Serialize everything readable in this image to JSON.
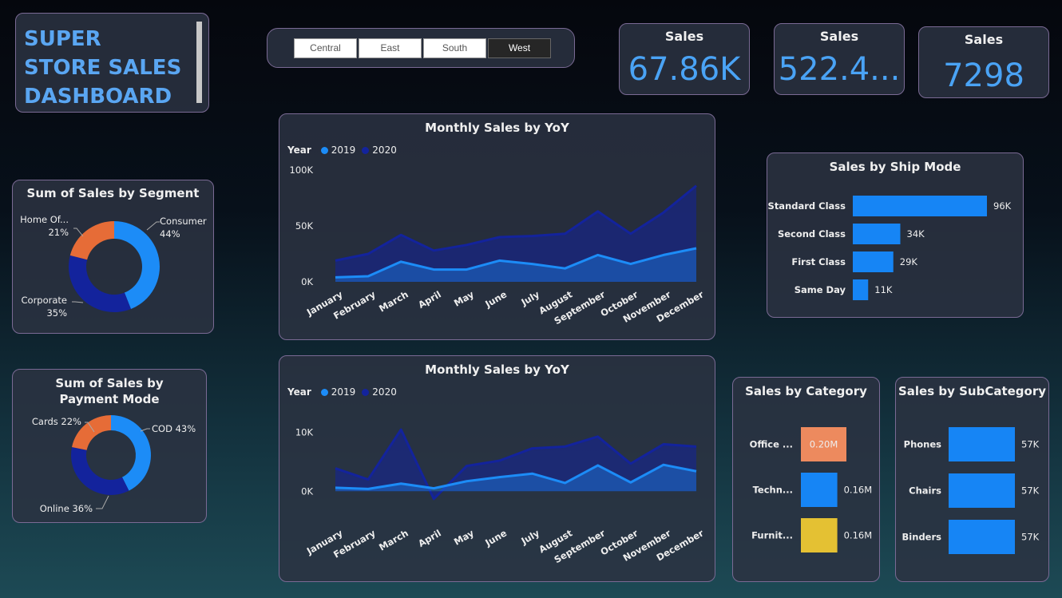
{
  "dashboard": {
    "title": "SUPER STORE SALES DASHBOARD"
  },
  "slicer": {
    "options": [
      "Central",
      "East",
      "South",
      "West"
    ],
    "selected": "West"
  },
  "kpis": [
    {
      "label": "Sales",
      "value": "67.86K"
    },
    {
      "label": "Sales",
      "value": "522.4..."
    },
    {
      "label": "Sales",
      "value": "7298"
    }
  ],
  "colors": {
    "c2019": "#1c8cf7",
    "c2020": "#13239c",
    "home": "#e66c37",
    "office": "#ed8a5e",
    "furniture": "#e4c133",
    "bar": "#1685f5"
  },
  "chart_data": [
    {
      "type": "pie",
      "title": "Sum of Sales by Segment",
      "slices": [
        {
          "label": "Consumer",
          "value": 44,
          "text": "44%"
        },
        {
          "label": "Corporate",
          "value": 35,
          "text": "35%"
        },
        {
          "label": "Home Of...",
          "value": 21,
          "text": "21%"
        }
      ]
    },
    {
      "type": "pie",
      "title": "Sum of Sales by Payment Mode",
      "slices": [
        {
          "label": "COD",
          "value": 43,
          "text": "COD 43%"
        },
        {
          "label": "Online",
          "value": 36,
          "text": "Online 36%"
        },
        {
          "label": "Cards",
          "value": 22,
          "text": "Cards 22%"
        }
      ]
    },
    {
      "type": "area",
      "title": "Monthly Sales by YoY",
      "legend_title": "Year",
      "categories": [
        "January",
        "February",
        "March",
        "April",
        "May",
        "June",
        "July",
        "August",
        "September",
        "October",
        "November",
        "December"
      ],
      "series": [
        {
          "name": "2019",
          "values": [
            4000,
            5000,
            18000,
            11000,
            11000,
            19000,
            16000,
            12000,
            24000,
            16000,
            24000,
            30000
          ]
        },
        {
          "name": "2020",
          "values": [
            19000,
            25000,
            42000,
            28000,
            33000,
            40000,
            41000,
            43000,
            63000,
            43000,
            62000,
            86000
          ]
        }
      ],
      "yticks": [
        {
          "v": 0,
          "label": "0K"
        },
        {
          "v": 50000,
          "label": "50K"
        },
        {
          "v": 100000,
          "label": "100K"
        }
      ],
      "ylim": [
        0,
        100000
      ]
    },
    {
      "type": "area",
      "title": "Monthly Sales by YoY",
      "legend_title": "Year",
      "categories": [
        "January",
        "February",
        "March",
        "April",
        "May",
        "June",
        "July",
        "August",
        "September",
        "October",
        "November",
        "December"
      ],
      "series": [
        {
          "name": "2019",
          "values": [
            600,
            400,
            1300,
            500,
            1700,
            2400,
            3000,
            1400,
            4400,
            1500,
            4500,
            3400
          ]
        },
        {
          "name": "2020",
          "values": [
            3900,
            2000,
            10500,
            -1300,
            4300,
            5200,
            7300,
            7600,
            9300,
            4700,
            8000,
            7600
          ]
        }
      ],
      "yticks": [
        {
          "v": 0,
          "label": "0K"
        },
        {
          "v": 10000,
          "label": "10K"
        }
      ],
      "ylim": [
        -2000,
        12000
      ]
    },
    {
      "type": "bar",
      "title": "Sales by Ship Mode",
      "categories": [
        "Standard Class",
        "Second Class",
        "First Class",
        "Same Day"
      ],
      "values": [
        96000,
        34000,
        29000,
        11000
      ],
      "labels": [
        "96K",
        "34K",
        "29K",
        "11K"
      ]
    },
    {
      "type": "bar",
      "title": "Sales by Category",
      "categories": [
        "Office ...",
        "Techn...",
        "Furnit..."
      ],
      "values": [
        0.2,
        0.16,
        0.16
      ],
      "labels": [
        "0.20M",
        "0.16M",
        "0.16M"
      ]
    },
    {
      "type": "bar",
      "title": "Sales by SubCategory",
      "categories": [
        "Phones",
        "Chairs",
        "Binders"
      ],
      "values": [
        57000,
        57000,
        57000
      ],
      "labels": [
        "57K",
        "57K",
        "57K"
      ]
    }
  ]
}
